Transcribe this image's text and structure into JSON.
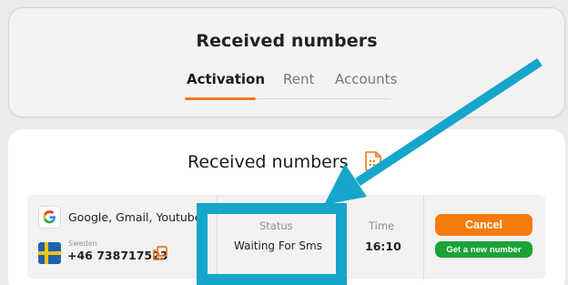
{
  "header": {
    "title": "Received numbers",
    "tabs": [
      {
        "label": "Activation",
        "active": true
      },
      {
        "label": "Rent",
        "active": false
      },
      {
        "label": "Accounts",
        "active": false
      }
    ]
  },
  "main": {
    "title": "Received numbers",
    "title_icon": "document-icon",
    "order": {
      "service": "Google, Gmail, Youtube",
      "service_icon": "google-icon",
      "country": "Sweden",
      "country_icon": "sweden-flag-icon",
      "phone_prefix": "+46",
      "phone_number": "738717523",
      "status_label": "Status",
      "status_value": "Waiting For Sms",
      "time_label": "Time",
      "time_value": "16:10",
      "cancel_label": "Cancel",
      "new_number_label": "Get a new number"
    }
  },
  "colors": {
    "accent": "#f07a1b",
    "cancel": "#f77b0c",
    "new_number": "#19a336",
    "annotation": "#16a6ca"
  }
}
